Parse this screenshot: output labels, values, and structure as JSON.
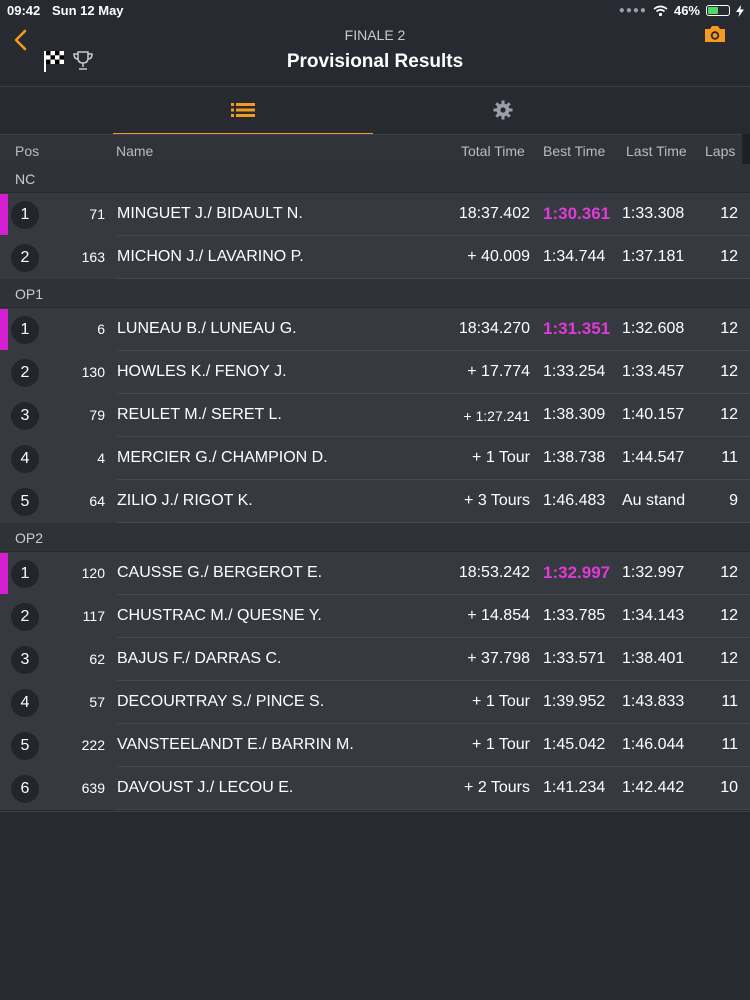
{
  "status": {
    "time": "09:42",
    "date": "Sun 12 May",
    "battery": "46%"
  },
  "header": {
    "subtitle": "FINALE 2",
    "title": "Provisional Results"
  },
  "colors": {
    "accent": "#f39a1f",
    "leader": "#d41ed0",
    "fastest": "#e03ad8"
  },
  "columns": {
    "pos": "Pos",
    "name": "Name",
    "total": "Total Time",
    "best": "Best Time",
    "last": "Last Time",
    "laps": "Laps"
  },
  "sections": [
    {
      "label": "NC",
      "rows": [
        {
          "pos": "1",
          "num": "71",
          "name": "MINGUET J./ BIDAULT N.",
          "total": "18:37.402",
          "best": "1:30.361",
          "last": "1:33.308",
          "laps": "12",
          "leader": true
        },
        {
          "pos": "2",
          "num": "163",
          "name": "MICHON J./ LAVARINO P.",
          "total": "+ 40.009",
          "best": "1:34.744",
          "last": "1:37.181",
          "laps": "12"
        }
      ]
    },
    {
      "label": "OP1",
      "rows": [
        {
          "pos": "1",
          "num": "6",
          "name": "LUNEAU B./ LUNEAU G.",
          "total": "18:34.270",
          "best": "1:31.351",
          "last": "1:32.608",
          "laps": "12",
          "leader": true
        },
        {
          "pos": "2",
          "num": "130",
          "name": "HOWLES K./ FENOY J.",
          "total": "+ 17.774",
          "best": "1:33.254",
          "last": "1:33.457",
          "laps": "12"
        },
        {
          "pos": "3",
          "num": "79",
          "name": "REULET M./ SERET L.",
          "total": "+ 1:27.241",
          "best": "1:38.309",
          "last": "1:40.157",
          "laps": "12"
        },
        {
          "pos": "4",
          "num": "4",
          "name": "MERCIER G./ CHAMPION D.",
          "total": "+ 1 Tour",
          "best": "1:38.738",
          "last": "1:44.547",
          "laps": "11"
        },
        {
          "pos": "5",
          "num": "64",
          "name": "ZILIO J./ RIGOT K.",
          "total": "+ 3 Tours",
          "best": "1:46.483",
          "last": "Au stand",
          "laps": "9"
        }
      ]
    },
    {
      "label": "OP2",
      "rows": [
        {
          "pos": "1",
          "num": "120",
          "name": "CAUSSE G./ BERGEROT E.",
          "total": "18:53.242",
          "best": "1:32.997",
          "last": "1:32.997",
          "laps": "12",
          "leader": true
        },
        {
          "pos": "2",
          "num": "117",
          "name": "CHUSTRAC M./ QUESNE Y.",
          "total": "+ 14.854",
          "best": "1:33.785",
          "last": "1:34.143",
          "laps": "12"
        },
        {
          "pos": "3",
          "num": "62",
          "name": "BAJUS F./ DARRAS C.",
          "total": "+ 37.798",
          "best": "1:33.571",
          "last": "1:38.401",
          "laps": "12"
        },
        {
          "pos": "4",
          "num": "57",
          "name": "DECOURTRAY S./ PINCE S.",
          "total": "+ 1 Tour",
          "best": "1:39.952",
          "last": "1:43.833",
          "laps": "11"
        },
        {
          "pos": "5",
          "num": "222",
          "name": "VANSTEELANDT E./ BARRIN M.",
          "total": "+ 1 Tour",
          "best": "1:45.042",
          "last": "1:46.044",
          "laps": "11"
        },
        {
          "pos": "6",
          "num": "639",
          "name": "DAVOUST J./ LECOU E.",
          "total": "+ 2 Tours",
          "best": "1:41.234",
          "last": "1:42.442",
          "laps": "10"
        }
      ]
    }
  ]
}
